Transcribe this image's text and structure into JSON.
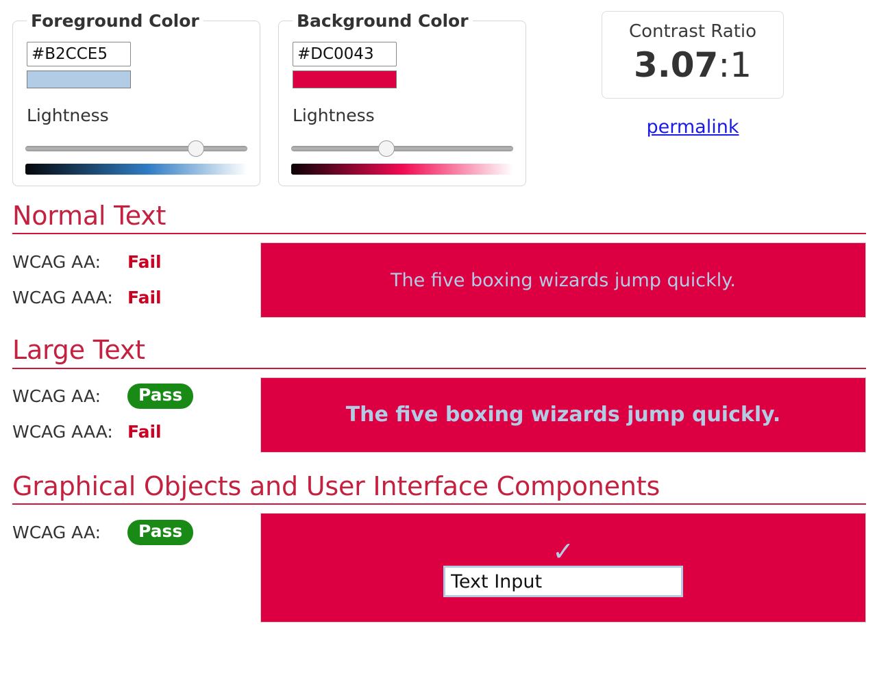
{
  "foreground": {
    "legend": "Foreground Color",
    "hex_value": "#B2CCE5",
    "hex_placeholder": "#B2CCE5",
    "swatch_color": "#B2CCE5",
    "lightness_label": "Lightness",
    "slider_percent": 77,
    "gradient_from": "#05080b",
    "gradient_mid": "#2f7cc4",
    "gradient_to": "#ffffff"
  },
  "background": {
    "legend": "Background Color",
    "hex_value": "#DC0043",
    "hex_placeholder": "#DC0043",
    "swatch_color": "#DC0043",
    "lightness_label": "Lightness",
    "slider_percent": 43,
    "gradient_from": "#0c0206",
    "gradient_mid": "#f20a52",
    "gradient_to": "#ffffff"
  },
  "contrast": {
    "title": "Contrast Ratio",
    "value": "3.07",
    "suffix": ":1",
    "permalink_label": "permalink",
    "permalink_color": "#1a1ae6"
  },
  "colors": {
    "heading": "#c42040",
    "rule": "#d1143c",
    "fail": "#cc0022",
    "pass_background": "#1a8a17",
    "pass_text": "#ffffff",
    "sample_background": "#DC0043",
    "sample_foreground": "#B2CCE5"
  },
  "sections": [
    {
      "heading": "Normal Text",
      "rows": [
        {
          "label": "WCAG AA:",
          "verdict": "Fail",
          "status": "fail"
        },
        {
          "label": "WCAG AAA:",
          "verdict": "Fail",
          "status": "fail"
        }
      ],
      "sample_text": "The five boxing wizards jump quickly."
    },
    {
      "heading": "Large Text",
      "rows": [
        {
          "label": "WCAG AA:",
          "verdict": "Pass",
          "status": "pass"
        },
        {
          "label": "WCAG AAA:",
          "verdict": "Fail",
          "status": "fail"
        }
      ],
      "sample_text": "The five boxing wizards jump quickly."
    },
    {
      "heading": "Graphical Objects and User Interface Components",
      "rows": [
        {
          "label": "WCAG AA:",
          "verdict": "Pass",
          "status": "pass"
        }
      ],
      "check_glyph": "✓",
      "input_value": "Text Input",
      "input_placeholder": "Text Input"
    }
  ]
}
